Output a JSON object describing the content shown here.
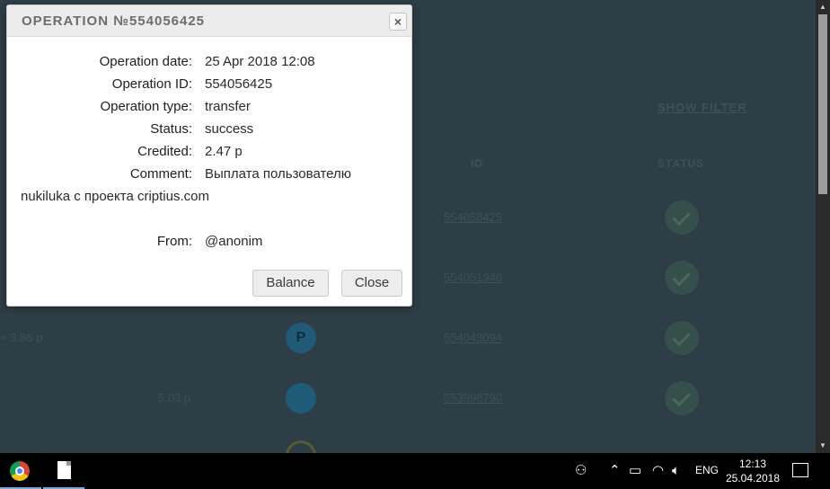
{
  "background": {
    "show_filter": "SHOW FILTER",
    "col_id": "ID",
    "col_status": "STATUS",
    "rows": [
      {
        "amount": "",
        "method": "",
        "id": "554056425"
      },
      {
        "amount": "",
        "method": "",
        "id": "554051940"
      },
      {
        "amount": "+ 3.86 р",
        "method": "P",
        "id": "554043094"
      },
      {
        "amount": "5.03 р",
        "method": "",
        "id": "553998790"
      }
    ]
  },
  "dialog": {
    "title": "OPERATION №554056425",
    "close_icon": "×",
    "fields": [
      {
        "label": "Operation date:",
        "value": "25 Apr 2018 12:08"
      },
      {
        "label": "Operation ID:",
        "value": "554056425"
      },
      {
        "label": "Operation type:",
        "value": "transfer"
      },
      {
        "label": "Status:",
        "value": "success"
      },
      {
        "label": "Credited:",
        "value": "2.47 р"
      },
      {
        "label": "Comment:",
        "value": "Выплата пользователю"
      }
    ],
    "comment_continuation": "nukiluka с проекта criptius.com",
    "from_label": "From:",
    "from_value": "@anonim",
    "balance_button": "Balance",
    "close_button": "Close"
  },
  "taskbar": {
    "apps": [
      "chrome-icon",
      "file-icon"
    ],
    "language": "ENG",
    "time": "12:13",
    "date": "25.04.2018"
  }
}
